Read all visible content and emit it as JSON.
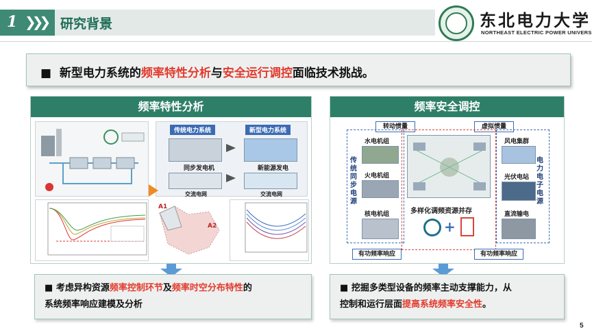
{
  "header": {
    "section_number": "1",
    "section_title": "研究背景",
    "university_cn": "东北电力大学",
    "university_en": "NORTHEAST ELECTRIC POWER UNIVERSITY"
  },
  "banner": {
    "bullet": "■",
    "part1": "新型电力系统的",
    "part2": "频率特性分析",
    "part3": "与",
    "part4": "安全运行调控",
    "part5": "面临技术挑战。"
  },
  "left_panel": {
    "title": "频率特性分析",
    "fig_traditional": "传统电力系统",
    "fig_new": "新型电力系统",
    "fig_sync": "同步发电机",
    "fig_newgen": "新能源发电",
    "fig_ac_old": "交流电网",
    "fig_ac_new": "交流电网",
    "area_a1": "A1",
    "area_a2": "A2"
  },
  "right_panel": {
    "title": "频率安全调控",
    "inertia_rot": "转动惯量",
    "inertia_virt": "虚拟惯量",
    "left_group_label": "传统同步电源",
    "right_group_label": "电力电子电源",
    "hydro": "水电机组",
    "thermal": "火电机组",
    "nuclear": "核电机组",
    "wind": "风电集群",
    "pv": "光伏电站",
    "hvdc": "直流输电",
    "coexist": "多样化调频资源并存",
    "resp_left": "有功频率响应",
    "resp_right": "有功频率响应"
  },
  "bottom_left": {
    "bullet": "■",
    "t1": "考虑异构资源",
    "t2": "频率控制环节",
    "t3": "及",
    "t4": "频率时空分布特性",
    "t5": "的",
    "line2": "系统频率响应建模及分析"
  },
  "bottom_right": {
    "bullet": "■",
    "line1": "挖掘多类型设备的频率主动支撑能力，从",
    "t1": "控制和运行层面",
    "t2": "提高系统频率安全性",
    "t3": "。"
  },
  "page_number": "5",
  "colors": {
    "accent": "#2e7f68",
    "highlight": "#e23b2d",
    "arrow": "#5b9bd5"
  }
}
